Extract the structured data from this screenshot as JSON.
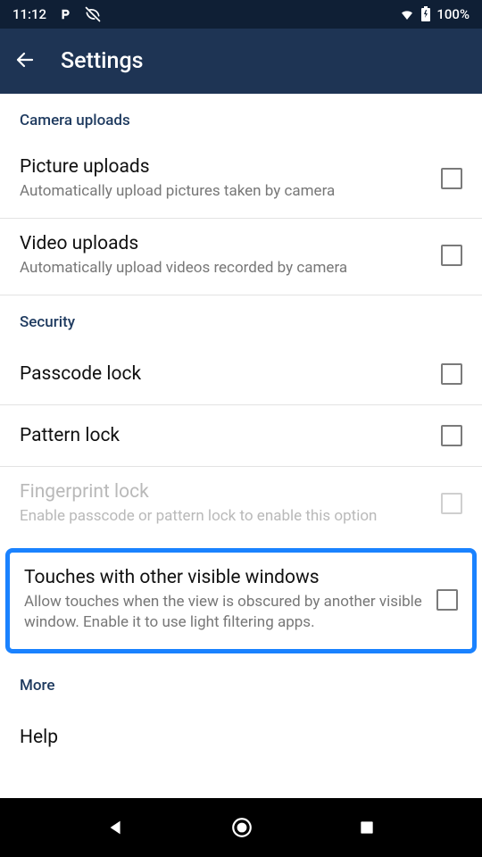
{
  "statusBar": {
    "time": "11:12",
    "batteryText": "100%"
  },
  "appBar": {
    "title": "Settings"
  },
  "sections": {
    "cameraUploads": {
      "header": "Camera uploads",
      "pictureUploads": {
        "title": "Picture uploads",
        "sub": "Automatically upload pictures taken by camera"
      },
      "videoUploads": {
        "title": "Video uploads",
        "sub": "Automatically upload videos recorded by camera"
      }
    },
    "security": {
      "header": "Security",
      "passcode": {
        "title": "Passcode lock"
      },
      "pattern": {
        "title": "Pattern lock"
      },
      "fingerprint": {
        "title": "Fingerprint lock",
        "sub": "Enable passcode or pattern lock to enable this option"
      },
      "touches": {
        "title": "Touches with other visible windows",
        "sub": "Allow touches when the view is obscured by another visible window. Enable it to use light filtering apps."
      }
    },
    "more": {
      "header": "More",
      "help": {
        "title": "Help"
      }
    }
  }
}
